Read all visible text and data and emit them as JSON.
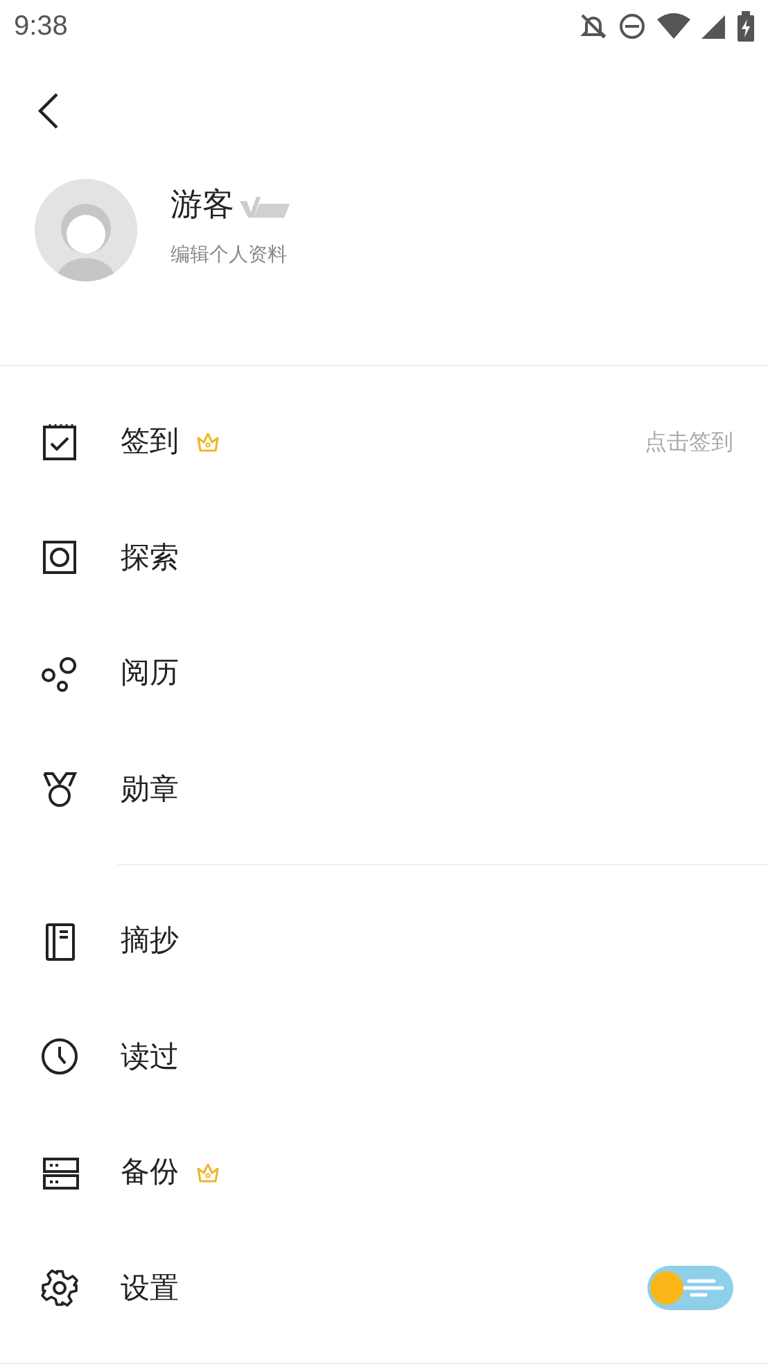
{
  "status_bar": {
    "time": "9:38"
  },
  "profile": {
    "name": "游客",
    "subtitle": "编辑个人资料"
  },
  "menu_groups": [
    {
      "items": [
        {
          "label": "签到",
          "vip": true,
          "hint": "点击签到"
        },
        {
          "label": "探索",
          "vip": false
        },
        {
          "label": "阅历",
          "vip": false
        },
        {
          "label": "勋章",
          "vip": false
        }
      ]
    },
    {
      "items": [
        {
          "label": "摘抄",
          "vip": false
        },
        {
          "label": "读过",
          "vip": false
        },
        {
          "label": "备份",
          "vip": true
        },
        {
          "label": "设置",
          "vip": false,
          "toggle": {
            "on": false
          }
        }
      ]
    }
  ]
}
